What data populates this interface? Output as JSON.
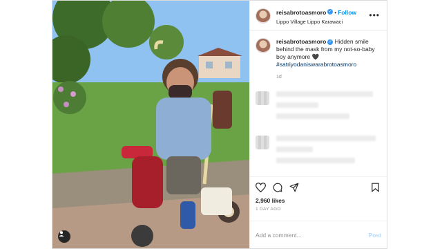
{
  "post": {
    "photo": {
      "alt_subject": "toddler-on-tricycle",
      "tag_icon": "user-tag-icon"
    },
    "header": {
      "username": "reisabrotoasmoro",
      "separator": "•",
      "follow_label": "Follow",
      "location": "Lippo Village Lippo Karawaci",
      "more_icon": "more-options-icon"
    },
    "caption": {
      "username": "reisabrotoasmoro",
      "text": "Hidden smile behind the mask from my not-so-baby boy anymore 🖤",
      "hashtag": "#satriyodaniswarabrotoasmoro",
      "time": "1d"
    },
    "actions": {
      "like_icon": "heart-icon",
      "comment_icon": "comment-icon",
      "share_icon": "share-icon",
      "save_icon": "bookmark-icon"
    },
    "likes": "2,960 likes",
    "date": "1 DAY AGO",
    "comment_box": {
      "placeholder": "Add a comment...",
      "post_label": "Post"
    },
    "colors": {
      "accent": "#0095f6",
      "verified": "#3897f0",
      "muted": "#8e8e8e",
      "border": "#dbdbdb"
    }
  }
}
